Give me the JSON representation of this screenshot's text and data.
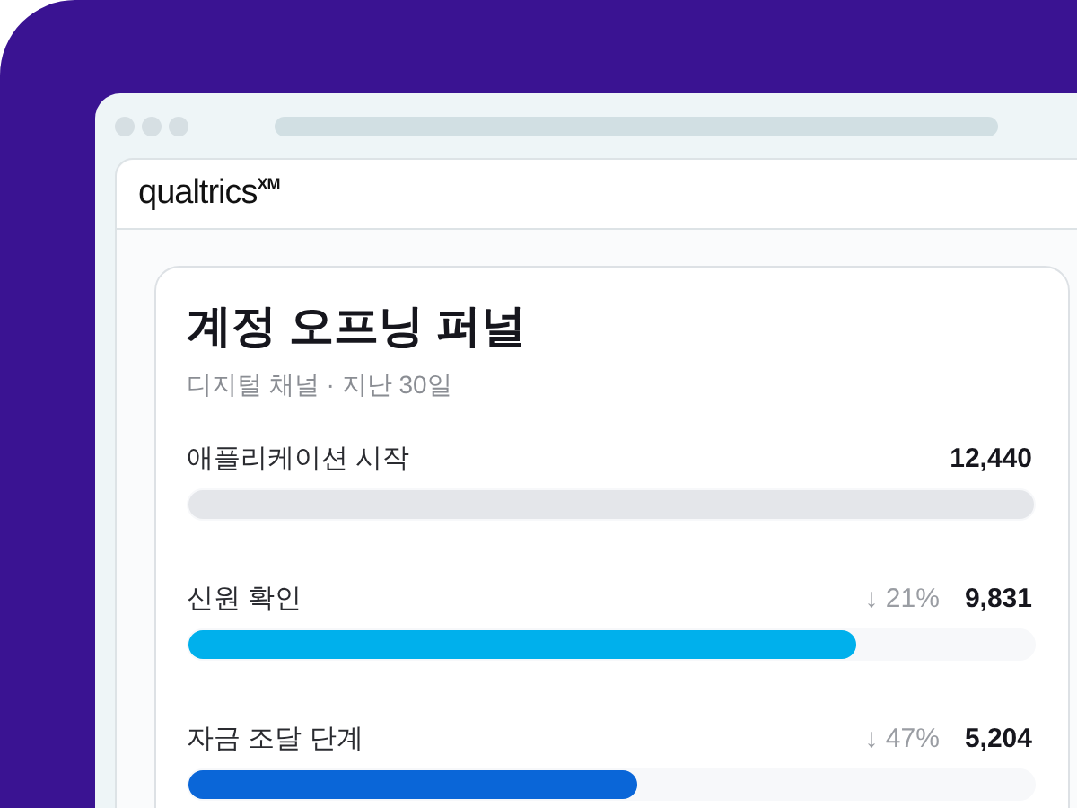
{
  "header": {
    "logo": "qualtrics$^{XM}$"
  },
  "card": {
    "title": "계정 오프닝 퍼널",
    "subtitle": "디지털 채널 · 지난 30일",
    "steps": [
      {
        "label": "애플리케이션 시작",
        "value": "12,440",
        "level": 1,
        "color": "#e4e6ea"
      },
      {
        "label": "신원 확인",
        "drop": "↓ 21%",
        "value": "9,831",
        "level": 0.79,
        "color": "#00b0ec"
      },
      {
        "label": "자금 조달 단계",
        "drop": "↓ 47%",
        "value": "5,204",
        "level": 0.53,
        "color": "#0a66d8"
      }
    ]
  }
}
